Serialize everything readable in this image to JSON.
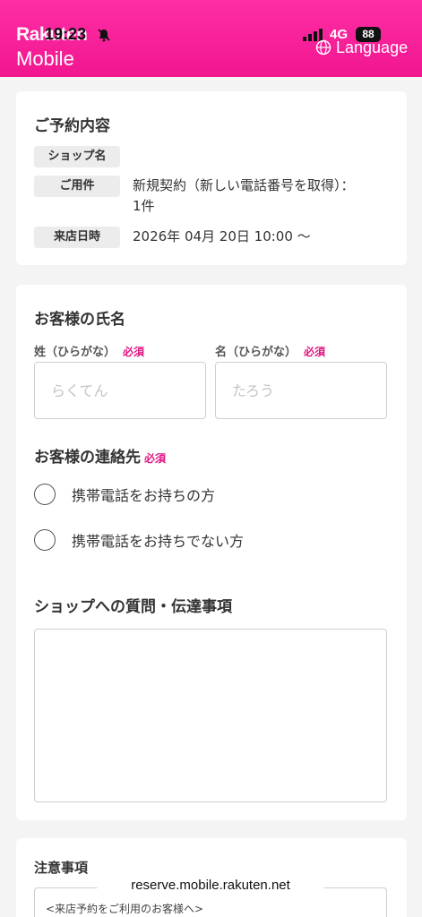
{
  "status_bar": {
    "logo_top": "Rakuten",
    "time": "19:23",
    "network": "4G",
    "battery": "88"
  },
  "header": {
    "logo": "Mobile",
    "language_label": "Language"
  },
  "reservation": {
    "title": "ご予約内容",
    "rows": [
      {
        "label": "ショップ名",
        "value": ""
      },
      {
        "label": "ご用件",
        "value": "新規契約（新しい電話番号を取得）：",
        "value2": "1件"
      },
      {
        "label": "来店日時",
        "value": "2026年 04月 20日 10:00 〜"
      }
    ]
  },
  "customer": {
    "name_title": "お客様の氏名",
    "last_name_label": "姓（ひらがな）",
    "first_name_label": "名（ひらがな）",
    "required": "必須",
    "last_name_placeholder": "らくてん",
    "first_name_placeholder": "たろう",
    "contact_title": "お客様の連絡先",
    "contact_options": [
      "携帯電話をお持ちの方",
      "携帯電話をお持ちでない方"
    ],
    "question_title": "ショップへの質問・伝達事項"
  },
  "notes": {
    "title": "注意事項",
    "first_line": "<来店予約をご利用のお客様へ>"
  },
  "browser": {
    "url": "reserve.mobile.rakuten.net"
  }
}
